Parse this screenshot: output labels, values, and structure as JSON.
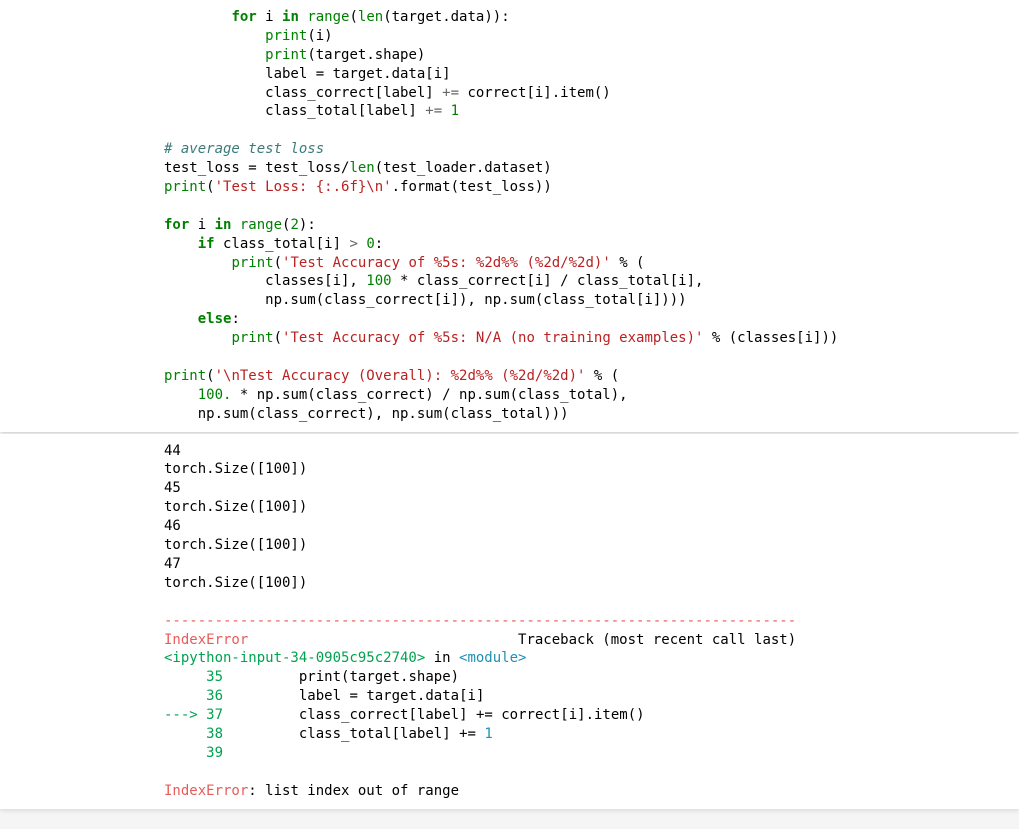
{
  "code": {
    "l1_for": "for",
    "l1_i": " i ",
    "l1_in": "in",
    "l1_range": " range",
    "l1_call": "(",
    "l1_len": "len",
    "l1_rest": "(target.data)):",
    "l2_print": "print",
    "l2_rest": "(i)",
    "l3_print": "print",
    "l3_rest": "(target.shape)",
    "l4": "            label = target.data[i]",
    "l5_a": "            class_correct[label] ",
    "l5_op": "+=",
    "l5_b": " correct[i].item()",
    "l6_a": "            class_total[label] ",
    "l6_op": "+=",
    "l6_b": " ",
    "l6_num": "1",
    "l7_comment": "# average test loss",
    "l8_a": "test_loss = test_loss/",
    "l8_len": "len",
    "l8_b": "(test_loader.dataset)",
    "l9_print": "print",
    "l9_po": "(",
    "l9_str": "'Test Loss: {:.6f}\\n'",
    "l9_rest": ".format(test_loss))",
    "l10_for": "for",
    "l10_i": " i ",
    "l10_in": "in",
    "l10_range": " range",
    "l10_po": "(",
    "l10_num": "2",
    "l10_rest": "):",
    "l11_if": "if",
    "l11_a": " class_total[i] ",
    "l11_op": ">",
    "l11_sp": " ",
    "l11_num": "0",
    "l11_colon": ":",
    "l12_print": "print",
    "l12_po": "(",
    "l12_str": "'Test Accuracy of %5s: %2d%% (%2d/%2d)'",
    "l12_rest": " % (",
    "l13_a": "            classes[i], ",
    "l13_num": "100",
    "l13_b": " * class_correct[i] / class_total[i],",
    "l14": "            np.sum(class_correct[i]), np.sum(class_total[i])))",
    "l15_else": "else",
    "l15_colon": ":",
    "l16_print": "print",
    "l16_po": "(",
    "l16_str": "'Test Accuracy of %5s: N/A (no training examples)'",
    "l16_rest": " % (classes[i]))",
    "l17_print": "print",
    "l17_po": "(",
    "l17_str": "'\\nTest Accuracy (Overall): %2d%% (%2d/%2d)'",
    "l17_rest": " % (",
    "l18_a": "    ",
    "l18_num": "100.",
    "l18_b": " * np.sum(class_correct) / np.sum(class_total),",
    "l19": "    np.sum(class_correct), np.sum(class_total)))"
  },
  "output": {
    "pre_lines": "44\ntorch.Size([100])\n45\ntorch.Size([100])\n46\ntorch.Size([100])\n47\ntorch.Size([100])\n",
    "dashes": "---------------------------------------------------------------------------",
    "err_name": "IndexError",
    "err_spaces": "                                ",
    "traceback_label": "Traceback (most recent call last)",
    "ipython_ref": "<ipython-input-34-0905c95c2740>",
    "in_word": " in ",
    "module_ref": "<module>",
    "tb35_no": "     35 ",
    "tb35_code": "        print(target.shape)",
    "tb35_print": "print",
    "tb35_po": "(",
    "tb35_a": "target",
    "tb35_dot": ".",
    "tb35_b": "shape",
    "tb35_pc": ")",
    "tb36_no": "     36 ",
    "tb36_a": "        label ",
    "tb36_eq": "=",
    "tb36_b": " target",
    "tb36_dot": ".",
    "tb36_c": "data",
    "tb36_br": "[",
    "tb36_i": "i",
    "tb36_bc": "]",
    "tb37_arrow": "---> ",
    "tb37_no": "37 ",
    "tb37_a": "        class_correct",
    "tb37_br1": "[",
    "tb37_l": "label",
    "tb37_bc1": "]",
    "tb37_sp1": " ",
    "tb37_op": "+=",
    "tb37_sp2": " ",
    "tb37_b": "correct",
    "tb37_br2": "[",
    "tb37_i": "i",
    "tb37_bc2": "]",
    "tb37_dot": ".",
    "tb37_c": "item",
    "tb37_po": "(",
    "tb37_pc": ")",
    "tb38_no": "     38 ",
    "tb38_a": "        class_total",
    "tb38_br": "[",
    "tb38_l": "label",
    "tb38_bc": "]",
    "tb38_sp1": " ",
    "tb38_op": "+=",
    "tb38_sp2": " ",
    "tb38_num": "1",
    "tb39_no": "     39 ",
    "final_err": "IndexError",
    "final_msg": ": list index out of range"
  }
}
